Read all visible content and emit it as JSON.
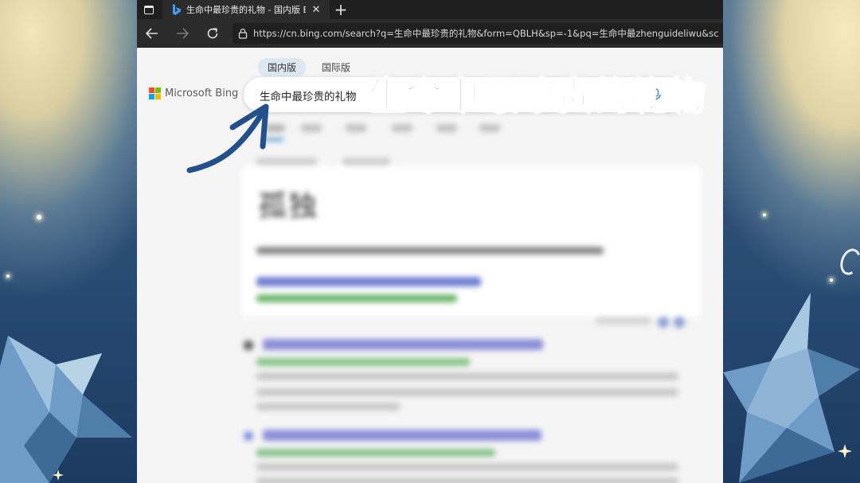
{
  "browser": {
    "tab_title": "生命中最珍贵的礼物 - 国内版 Bing",
    "url": "https://cn.bing.com/search?q=生命中最珍贵的礼物&form=QBLH&sp=-1&pq=生命中最zhenguideliwu&sc"
  },
  "bing": {
    "scope_tabs": [
      "国内版",
      "国际版"
    ],
    "logo_text": "Microsoft Bing",
    "query": "生命中最珍贵的礼物"
  },
  "results": {
    "answer_word": "孤独"
  },
  "overlay": {
    "headline": "生命中最珍贵的礼物"
  },
  "colors": {
    "accent": "#1d4a8c",
    "tab_bg": "#2b2b2b",
    "chrome_bg": "#1f1f1f"
  }
}
